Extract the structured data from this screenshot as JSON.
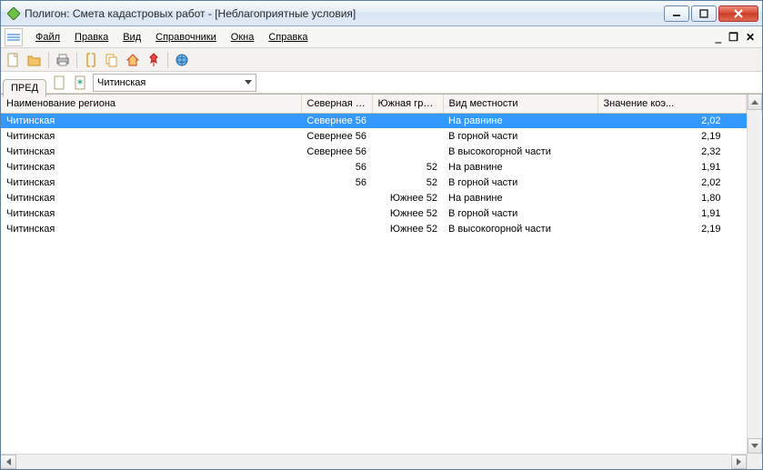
{
  "title": "Полигон: Смета кадастровых работ - [Неблагоприятные условия]",
  "menu": {
    "file": "Файл",
    "edit": "Правка",
    "view": "Вид",
    "dict": "Справочники",
    "windows": "Окна",
    "help": "Справка"
  },
  "tab_left": "ПРЕД",
  "combo_value": "Читинская",
  "columns": {
    "region": "Наименование региона",
    "north": "Северная г...",
    "south": "Южная гра...",
    "terrain": "Вид местности",
    "coef": "Значение коэ..."
  },
  "rows": [
    {
      "region": "Читинская",
      "north": "Севернее 56",
      "south": "",
      "terrain": "На равнине",
      "coef": "2,02",
      "selected": true
    },
    {
      "region": "Читинская",
      "north": "Севернее 56",
      "south": "",
      "terrain": "В горной части",
      "coef": "2,19"
    },
    {
      "region": "Читинская",
      "north": "Севернее 56",
      "south": "",
      "terrain": "В высокогорной части",
      "coef": "2,32"
    },
    {
      "region": "Читинская",
      "north": "56",
      "south": "52",
      "terrain": "На равнине",
      "coef": "1,91"
    },
    {
      "region": "Читинская",
      "north": "56",
      "south": "52",
      "terrain": "В горной части",
      "coef": "2,02"
    },
    {
      "region": "Читинская",
      "north": "",
      "south": "Южнее 52",
      "terrain": "На равнине",
      "coef": "1,80"
    },
    {
      "region": "Читинская",
      "north": "",
      "south": "Южнее 52",
      "terrain": "В горной части",
      "coef": "1,91"
    },
    {
      "region": "Читинская",
      "north": "",
      "south": "Южнее 52",
      "terrain": "В высокогорной части",
      "coef": "2,19"
    }
  ],
  "icons": {
    "app": "app-icon",
    "new": "new-doc-icon",
    "open": "open-folder-icon",
    "print": "printer-icon",
    "tool1": "bracket-icon",
    "copydoc": "copy-doc-icon",
    "home": "home-icon",
    "pin": "pin-icon",
    "globe": "globe-icon",
    "copy2": "page-icon",
    "new2": "new-page-icon"
  }
}
